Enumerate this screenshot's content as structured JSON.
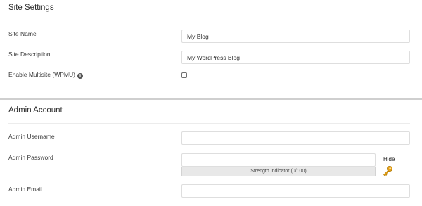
{
  "site_settings": {
    "title": "Site Settings",
    "site_name_label": "Site Name",
    "site_name_value": "My Blog",
    "site_description_label": "Site Description",
    "site_description_value": "My WordPress Blog",
    "multisite_label": "Enable Multisite (WPMU)",
    "multisite_checked": false
  },
  "admin_account": {
    "title": "Admin Account",
    "username_label": "Admin Username",
    "username_value": "",
    "password_label": "Admin Password",
    "password_value": "",
    "hide_label": "Hide",
    "strength_indicator": "Strength Indicator (0/100)",
    "email_label": "Admin Email",
    "email_value": ""
  },
  "icons": {
    "info": "info-icon",
    "key": "key-icon"
  },
  "colors": {
    "key_icon": "#e8a317",
    "separator": "#cfcfcf"
  }
}
